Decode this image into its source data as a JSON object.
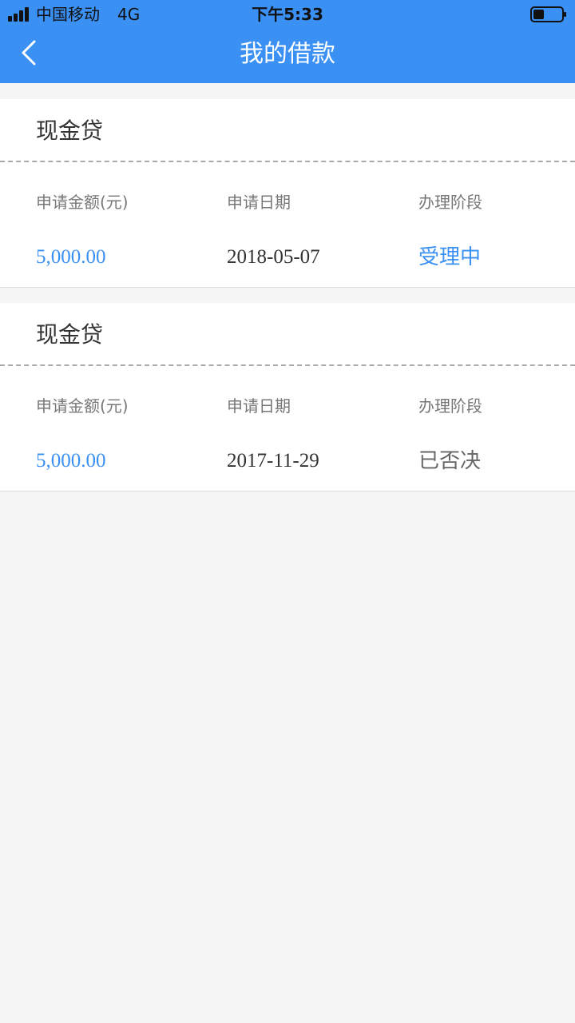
{
  "status_bar": {
    "carrier": "中国移动",
    "network": "4G",
    "time": "下午5:33"
  },
  "nav": {
    "title": "我的借款"
  },
  "labels": {
    "amount": "申请金额(元)",
    "date": "申请日期",
    "stage": "办理阶段"
  },
  "loans": [
    {
      "product": "现金贷",
      "amount": "5,000.00",
      "date": "2018-05-07",
      "stage": "受理中",
      "stage_color": "#3a90f3"
    },
    {
      "product": "现金贷",
      "amount": "5,000.00",
      "date": "2017-11-29",
      "stage": "已否决",
      "stage_color": "#666666"
    }
  ],
  "colors": {
    "brand": "#3a90f3",
    "amount": "#3a90f3"
  }
}
